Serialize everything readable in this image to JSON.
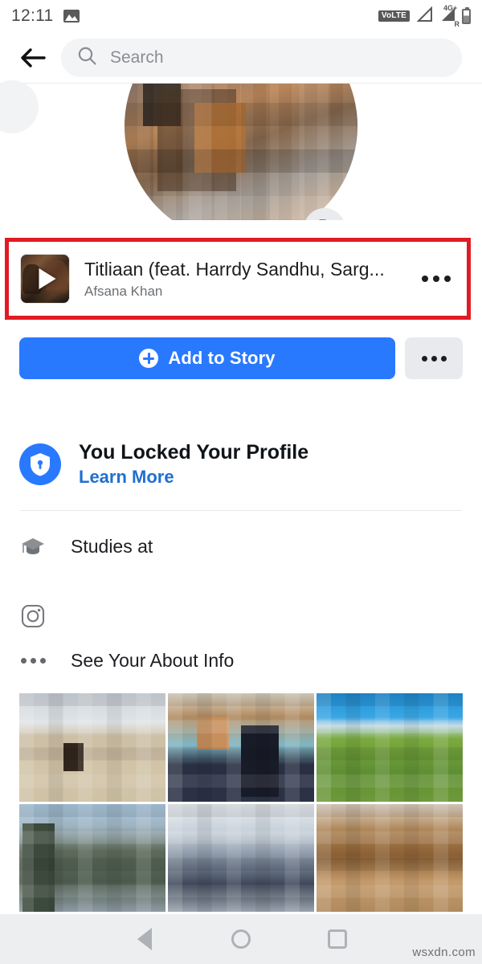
{
  "status_bar": {
    "time": "12:11",
    "left_icons": [
      "photo-icon"
    ],
    "right_icons": [
      "volte-icon",
      "signal-triangle-icon",
      "4g-signal-roaming-icon",
      "battery-icon"
    ],
    "volte_label": "VoLTE",
    "network_label": "4G+",
    "roaming_label": "R"
  },
  "header": {
    "back_icon": "back-arrow-icon",
    "search": {
      "icon": "search-icon",
      "placeholder": "Search",
      "value": ""
    }
  },
  "profile": {
    "photo_alt": "profile-photo",
    "camera_button_icon": "camera-icon"
  },
  "song_card": {
    "highlighted": true,
    "highlight_color": "#e01b24",
    "title": "Titliaan (feat. Harrdy Sandhu, Sarg...",
    "artist": "Afsana Khan",
    "play_icon": "play-icon",
    "more_icon": "more-horizontal-icon"
  },
  "actions": {
    "add_to_story_label": "Add to Story",
    "add_to_story_color": "#2979ff",
    "plus_icon": "plus-circle-icon",
    "more_icon": "more-horizontal-icon"
  },
  "locked_profile": {
    "icon": "shield-lock-icon",
    "title": "You Locked Your Profile",
    "link_label": "Learn More",
    "link_color": "#1f6fd0"
  },
  "about": [
    {
      "icon": "graduation-cap-icon",
      "label": "Studies at"
    },
    {
      "icon": "instagram-icon",
      "label": ""
    },
    {
      "icon": "more-horizontal-icon",
      "label": "See Your About Info"
    }
  ],
  "photo_grid": {
    "columns": 3,
    "rows": 2,
    "cells": [
      {
        "name": "photo-1"
      },
      {
        "name": "photo-2"
      },
      {
        "name": "photo-3"
      },
      {
        "name": "photo-4"
      },
      {
        "name": "photo-5"
      },
      {
        "name": "photo-6"
      }
    ]
  },
  "nav_bar": {
    "back_icon": "nav-back-icon",
    "home_icon": "nav-home-icon",
    "recents_icon": "nav-recents-icon"
  },
  "watermark": "wsxdn.com"
}
